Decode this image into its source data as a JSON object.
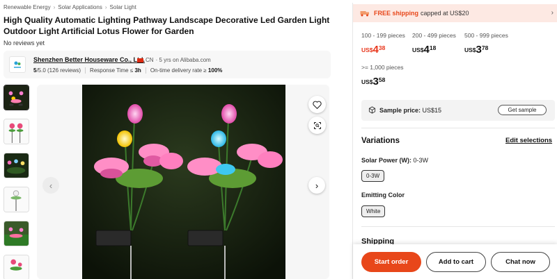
{
  "breadcrumb": [
    "Renewable Energy",
    "Solar Applications",
    "Solar Light"
  ],
  "product": {
    "title": "High Quality Automatic Lighting Pathway Landscape Decorative Led Garden Light Outdoor Light Artificial Lotus Flower for Garden",
    "reviews_text": "No reviews yet"
  },
  "supplier": {
    "name": "Shenzhen Better Houseware Co., Ltd.",
    "country": "CN",
    "years_site": "· 5 yrs on Alibaba.com",
    "rating": "5",
    "rating_rest": "/5.0 (126 reviews)",
    "response_label": "Response Time ≤",
    "response_value": "3h",
    "delivery_label": "On-time delivery rate ≥",
    "delivery_value": "100%"
  },
  "shipping_banner": {
    "free": "FREE shipping",
    "rest": "capped at US$20"
  },
  "price_tiers": [
    {
      "range": "100 - 199 pieces",
      "currency": "US$",
      "int": "4",
      "dec": "38",
      "highlight": true
    },
    {
      "range": "200 - 499 pieces",
      "currency": "US$",
      "int": "4",
      "dec": "18",
      "highlight": false
    },
    {
      "range": "500 - 999 pieces",
      "currency": "US$",
      "int": "3",
      "dec": "78",
      "highlight": false
    },
    {
      "range": ">= 1,000 pieces",
      "currency": "US$",
      "int": "3",
      "dec": "58",
      "highlight": false
    }
  ],
  "sample": {
    "label": "Sample price:",
    "price": "US$15",
    "button": "Get sample"
  },
  "variations": {
    "title": "Variations",
    "edit": "Edit selections",
    "solar_power_label": "Solar Power (W):",
    "solar_power_value": "0-3W",
    "solar_power_chip": "0-3W",
    "emitting_label": "Emitting Color",
    "emitting_chip": "White"
  },
  "shipping_heading": "Shipping",
  "actions": {
    "start_order": "Start order",
    "add_to_cart": "Add to cart",
    "chat_now": "Chat now"
  },
  "icons": {
    "next": "›",
    "prev": "‹",
    "chevron": "›"
  },
  "colors": {
    "accent": "#e8471a",
    "price_red": "#e8351a",
    "banner_bg": "#fde9e3"
  }
}
